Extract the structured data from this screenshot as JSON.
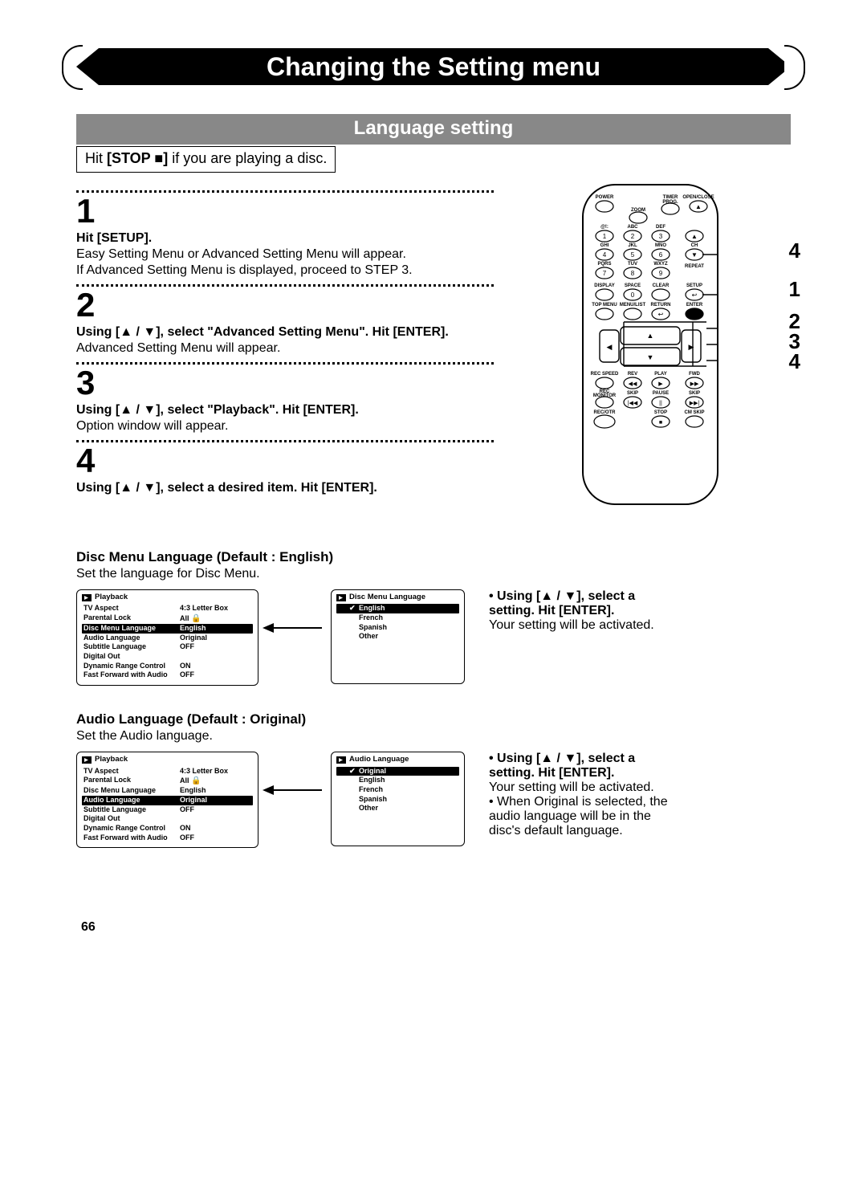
{
  "header": {
    "title": "Changing the Setting menu",
    "subtitle": "Language setting",
    "hit_stop": "Hit [STOP ■] if you are playing a disc."
  },
  "steps": [
    {
      "num": "1",
      "head": "Hit [SETUP].",
      "text1": "Easy Setting Menu or Advanced Setting Menu will appear.",
      "text2": "If Advanced Setting Menu is displayed, proceed to STEP 3."
    },
    {
      "num": "2",
      "head": "Using [▲ / ▼], select \"Advanced Setting Menu\". Hit [ENTER].",
      "text1": "Advanced Setting Menu will appear."
    },
    {
      "num": "3",
      "head": "Using [▲ / ▼], select \"Playback\". Hit [ENTER].",
      "text1": "Option window will appear."
    },
    {
      "num": "4",
      "head": "Using [▲ / ▼], select a desired item. Hit [ENTER]."
    }
  ],
  "discMenu": {
    "heading": "Disc Menu Language (Default : English)",
    "sub": "Set the language for Disc Menu.",
    "side": "• Using [▲ / ▼], select a setting. Hit [ENTER].",
    "side2": "Your setting will be activated."
  },
  "audio": {
    "heading": "Audio Language (Default : Original)",
    "sub": "Set the Audio language.",
    "side": "• Using [▲ / ▼], select a setting. Hit [ENTER].",
    "side2": "Your setting will be activated.",
    "side3": "• When Original is selected, the audio language will be in the disc's default language."
  },
  "playbackOSD": {
    "title": "Playback",
    "rows": [
      {
        "label": "TV Aspect",
        "val": "4:3 Letter Box"
      },
      {
        "label": "Parental Lock",
        "val": "All 🔒"
      },
      {
        "label": "Disc Menu Language",
        "val": "English"
      },
      {
        "label": "Audio Language",
        "val": "Original"
      },
      {
        "label": "Subtitle Language",
        "val": "OFF"
      },
      {
        "label": "Digital Out",
        "val": ""
      },
      {
        "label": "Dynamic Range Control",
        "val": "ON"
      },
      {
        "label": "Fast Forward with Audio",
        "val": "OFF"
      }
    ]
  },
  "discMenuOSD": {
    "title": "Disc Menu Language",
    "items": [
      "English",
      "French",
      "Spanish",
      "Other"
    ],
    "checked": 0
  },
  "audioOSD": {
    "title": "Audio Language",
    "items": [
      "Original",
      "English",
      "French",
      "Spanish",
      "Other"
    ],
    "checked": 0
  },
  "remote": {
    "row1": [
      "POWER",
      "",
      "TIMER PROG.",
      "OPEN/CLOSE"
    ],
    "row2": [
      "",
      "ZOOM",
      "",
      "▲"
    ],
    "keypad_top": [
      "@!:",
      "ABC",
      "DEF",
      ""
    ],
    "keypad": [
      [
        "1",
        "2",
        "3",
        "▲"
      ],
      [
        "4",
        "5",
        "6",
        "▼"
      ],
      [
        "7",
        "8",
        "9",
        ""
      ]
    ],
    "keypad_mid_labels": [
      "GHI",
      "JKL",
      "MNO",
      "CH"
    ],
    "keypad_bot_labels": [
      "PQRS",
      "TUV",
      "WXYZ",
      "REPEAT"
    ],
    "row_disp_labels": [
      "DISPLAY",
      "SPACE",
      "CLEAR",
      "SETUP"
    ],
    "row_disp": [
      "",
      "0",
      "",
      "↩"
    ],
    "row_menu_labels": [
      "TOP MENU",
      "MENU/LIST",
      "RETURN",
      "ENTER"
    ],
    "row_menu": [
      "",
      "",
      "↩",
      "●"
    ],
    "dpad": [
      "◀",
      "▲",
      "▼",
      "▶"
    ],
    "row_rec_labels": [
      "REC SPEED",
      "REV",
      "PLAY",
      "FWD"
    ],
    "row_rec": [
      "",
      "◀◀",
      "▶",
      "▶▶"
    ],
    "row_rec2_labels": [
      "REC MONITOR",
      "SKIP",
      "PAUSE",
      "SKIP"
    ],
    "row_rec2": [
      "",
      "|◀◀",
      "||",
      "▶▶|"
    ],
    "row_bottom_labels": [
      "REC/OTR",
      "",
      "STOP",
      "CM SKIP"
    ],
    "row_bottom": [
      "",
      "",
      "■",
      ""
    ]
  },
  "callouts": [
    "4",
    "1",
    "2",
    "3",
    "4"
  ],
  "pageNum": "66"
}
